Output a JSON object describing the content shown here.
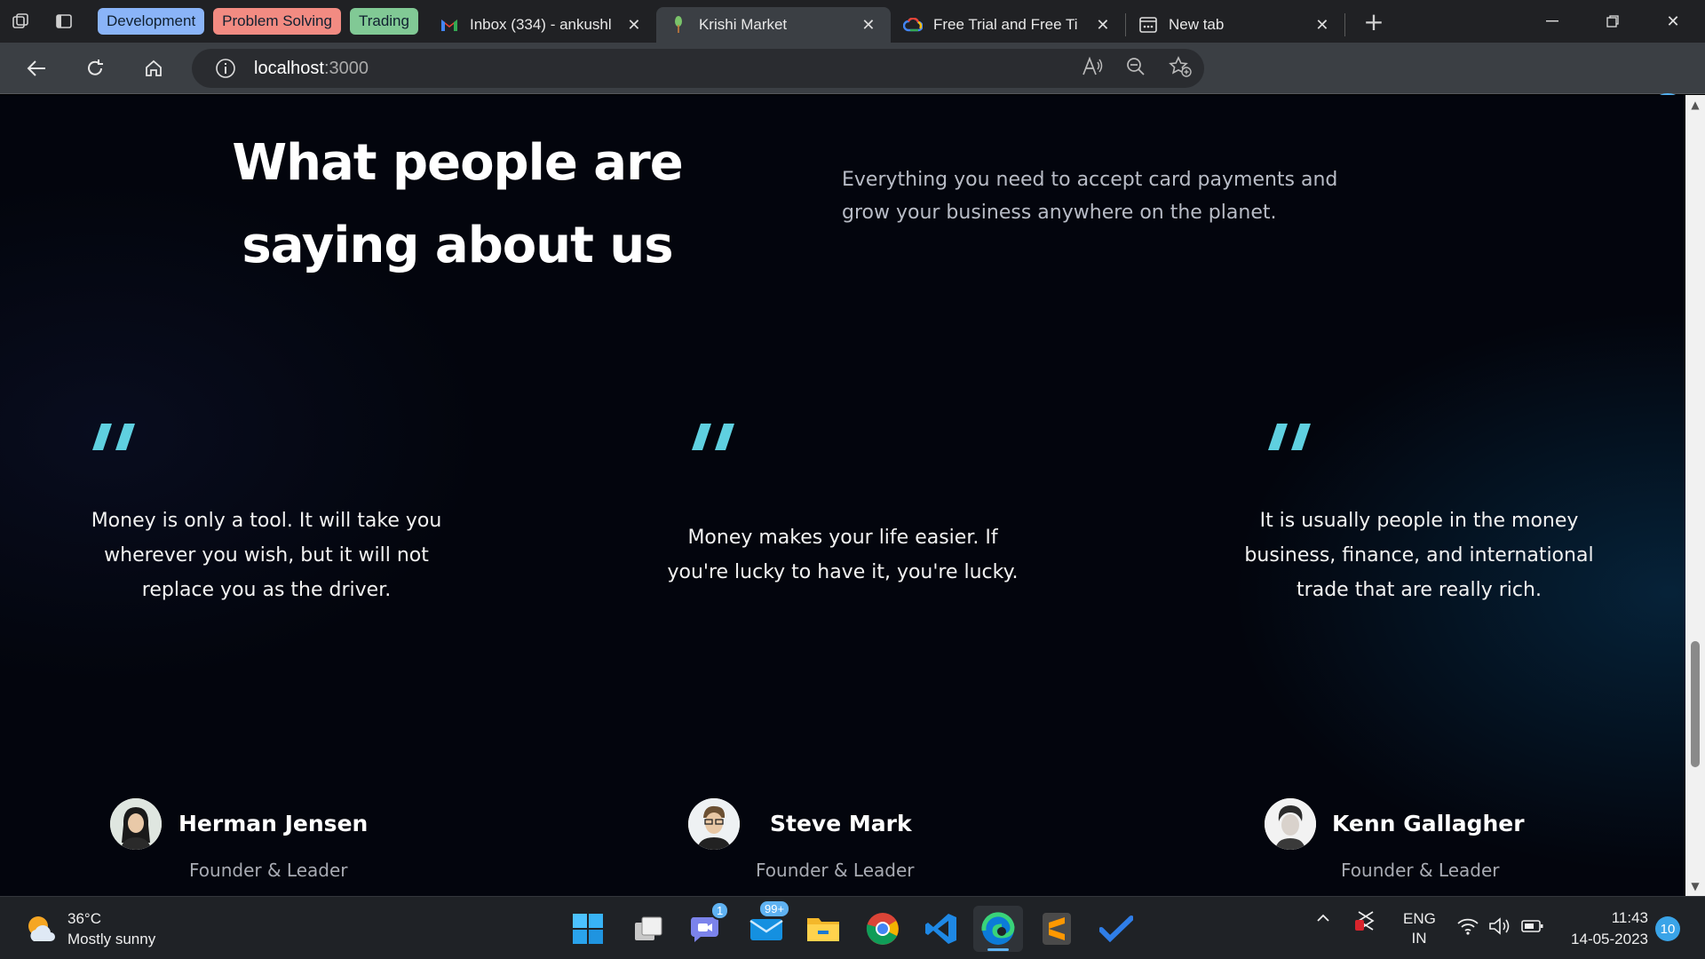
{
  "browser": {
    "tab_groups": [
      {
        "label": "Development",
        "color": "#8ab4f8"
      },
      {
        "label": "Problem Solving",
        "color": "#f28b82"
      },
      {
        "label": "Trading",
        "color": "#81c995"
      }
    ],
    "tabs": [
      {
        "title": "Inbox (334) - ankushl",
        "favicon": "gmail-icon"
      },
      {
        "title": "Krishi Market",
        "favicon": "leaf-icon",
        "active": true
      },
      {
        "title": "Free Trial and Free Ti",
        "favicon": "google-cloud-icon"
      },
      {
        "title": "New tab",
        "favicon": "new-tab-icon"
      }
    ],
    "url_host": "localhost",
    "url_port": ":3000"
  },
  "testimonials": {
    "heading_line1": "What people are",
    "heading_line2": "saying about us",
    "subtext": "Everything you need to accept card payments and grow your business anywhere on the planet.",
    "accent_color": "#5fd0e0",
    "items": [
      {
        "quote": "Money is only a tool. It will take you wherever you wish, but it will not replace you as the driver.",
        "name": "Herman Jensen",
        "role": "Founder & Leader"
      },
      {
        "quote": "Money makes your life easier. If you're lucky to have it, you're lucky.",
        "name": "Steve Mark",
        "role": "Founder & Leader"
      },
      {
        "quote": "It is usually people in the money business, finance, and international trade that are really rich.",
        "name": "Kenn Gallagher",
        "role": "Founder & Leader"
      }
    ]
  },
  "taskbar": {
    "temperature": "36°C",
    "weather": "Mostly sunny",
    "teams_badge": "1",
    "mail_badge": "99+",
    "language": "ENG",
    "region": "IN",
    "time": "11:43",
    "date": "14-05-2023",
    "notifications": "10"
  }
}
